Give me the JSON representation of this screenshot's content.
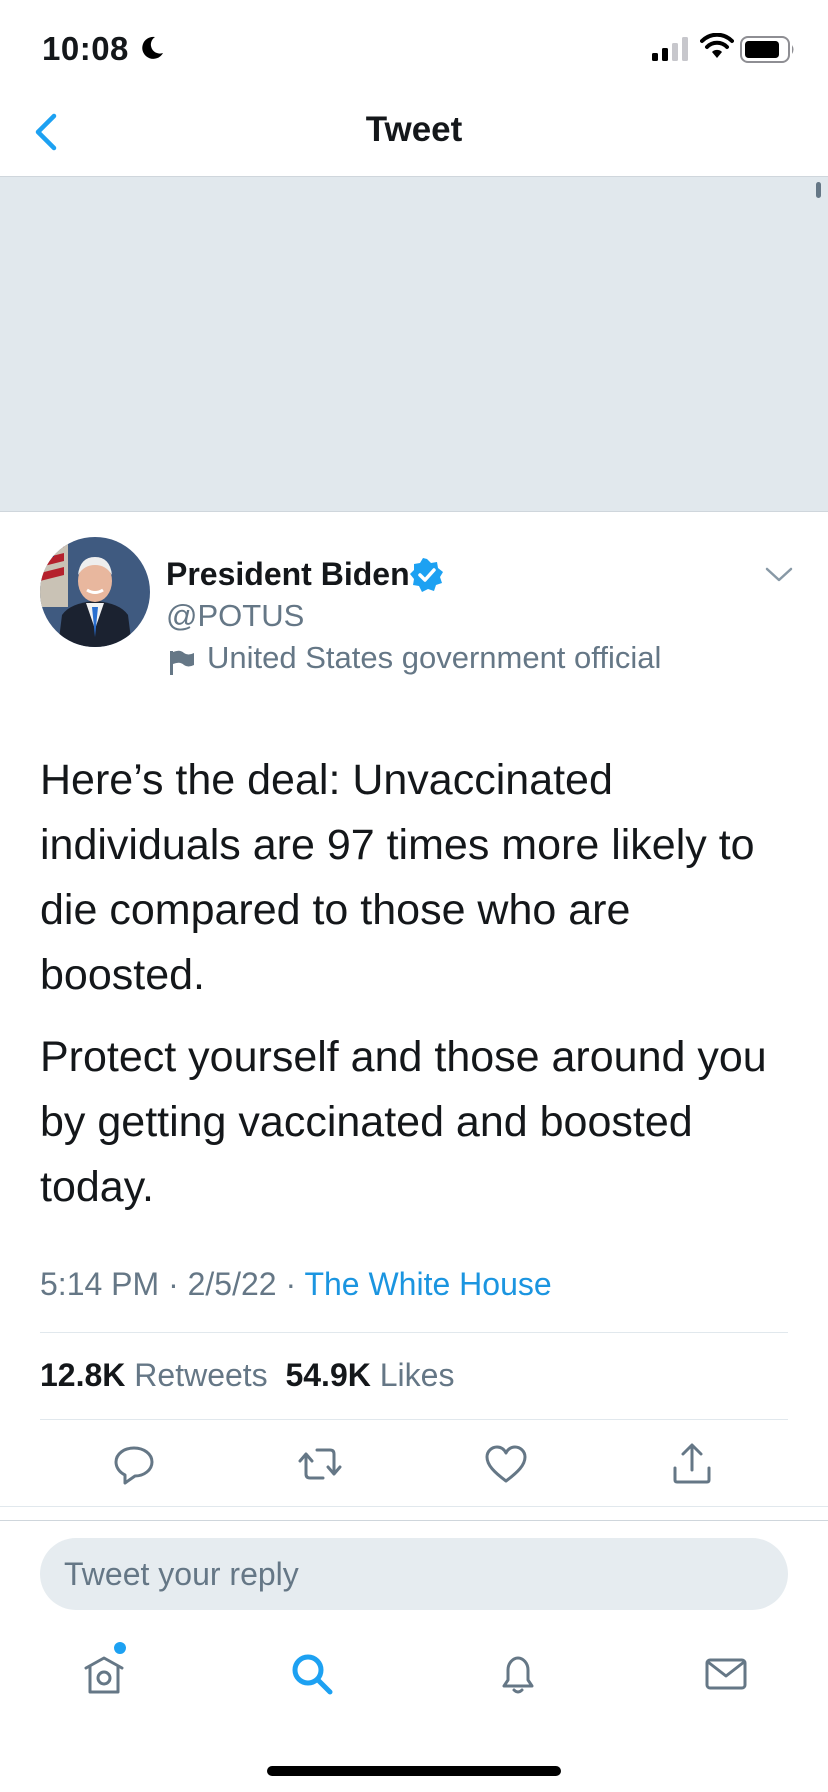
{
  "status_bar": {
    "time": "10:08"
  },
  "header": {
    "title": "Tweet"
  },
  "author": {
    "name": "President Biden",
    "handle": "@POTUS",
    "label": "United States government official"
  },
  "tweet": {
    "paragraphs": [
      "Here’s the deal: Unvaccinated individuals are 97 times more likely to die compared to those who are boosted.",
      "Protect yourself and those around you by getting vaccinated and boosted today."
    ],
    "time": "5:14 PM",
    "date": "2/5/22",
    "separator": "·",
    "source": "The White House"
  },
  "stats": {
    "retweets_count": "12.8K",
    "retweets_label": "Retweets",
    "likes_count": "54.9K",
    "likes_label": "Likes"
  },
  "reply": {
    "placeholder": "Tweet your reply"
  },
  "colors": {
    "accent": "#1da1f2",
    "link": "#1b95e0",
    "secondary_text": "#657786",
    "media_bg": "#e1e8ed"
  },
  "icons": {
    "back": "chevron-left-icon",
    "verified": "verified-badge-icon",
    "caret": "chevron-down-icon",
    "reply": "reply-icon",
    "retweet": "retweet-icon",
    "like": "heart-icon",
    "share": "share-icon",
    "tab_home": "home-icon",
    "tab_search": "search-icon",
    "tab_notifications": "bell-icon",
    "tab_messages": "mail-icon"
  }
}
